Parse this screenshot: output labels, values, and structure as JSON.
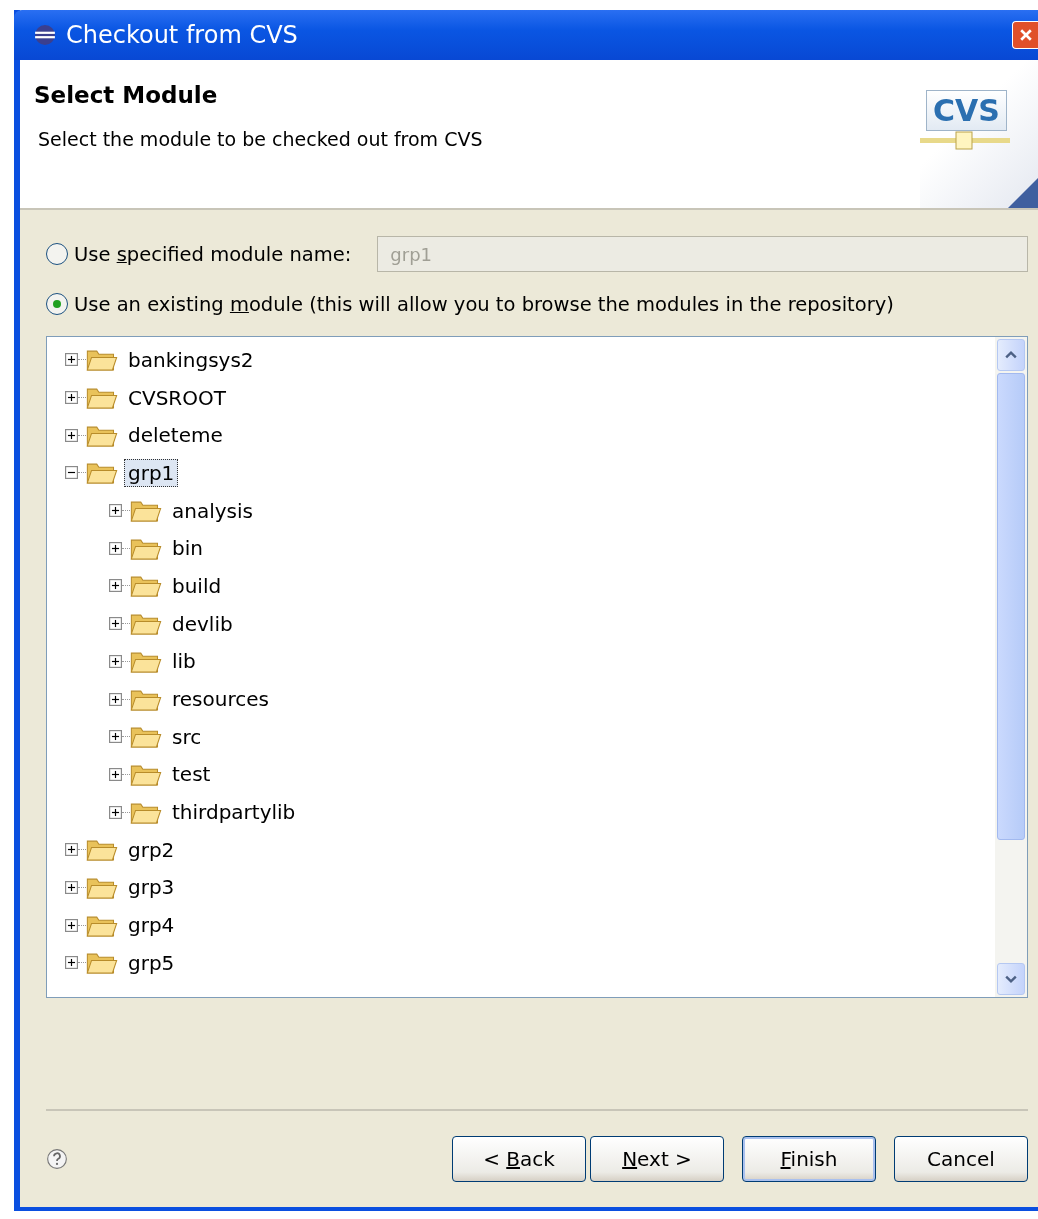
{
  "window": {
    "title": "Checkout from CVS"
  },
  "header": {
    "title": "Select Module",
    "description": "Select the module to be checked out from CVS",
    "badge": "CVS"
  },
  "options": [
    {
      "label": {
        "before": "Use ",
        "key": "s",
        "after": "pecified module name:"
      },
      "selected": false,
      "field": {
        "value": "grp1",
        "disabled": true
      }
    },
    {
      "label": {
        "before": "Use an existing ",
        "key": "m",
        "after": "odule (this will allow you to browse the modules in the repository)"
      },
      "selected": true
    }
  ],
  "tree": [
    {
      "label": "bankingsys2",
      "expanded": false,
      "selected": false
    },
    {
      "label": "CVSROOT",
      "expanded": false,
      "selected": false
    },
    {
      "label": "deleteme",
      "expanded": false,
      "selected": false
    },
    {
      "label": "grp1",
      "expanded": true,
      "selected": true,
      "children": [
        {
          "label": "analysis",
          "expanded": false,
          "selected": false
        },
        {
          "label": "bin",
          "expanded": false,
          "selected": false
        },
        {
          "label": "build",
          "expanded": false,
          "selected": false
        },
        {
          "label": "devlib",
          "expanded": false,
          "selected": false
        },
        {
          "label": "lib",
          "expanded": false,
          "selected": false
        },
        {
          "label": "resources",
          "expanded": false,
          "selected": false
        },
        {
          "label": "src",
          "expanded": false,
          "selected": false
        },
        {
          "label": "test",
          "expanded": false,
          "selected": false
        },
        {
          "label": "thirdpartylib",
          "expanded": false,
          "selected": false
        }
      ]
    },
    {
      "label": "grp2",
      "expanded": false,
      "selected": false
    },
    {
      "label": "grp3",
      "expanded": false,
      "selected": false
    },
    {
      "label": "grp4",
      "expanded": false,
      "selected": false
    },
    {
      "label": "grp5",
      "expanded": false,
      "selected": false
    }
  ],
  "buttons": [
    {
      "before": "< ",
      "key": "B",
      "after": "ack",
      "default": false
    },
    {
      "key": "N",
      "after": "ext >",
      "default": false
    },
    {
      "key": "F",
      "after": "inish",
      "default": true
    },
    {
      "before": "Cancel",
      "default": false
    }
  ]
}
